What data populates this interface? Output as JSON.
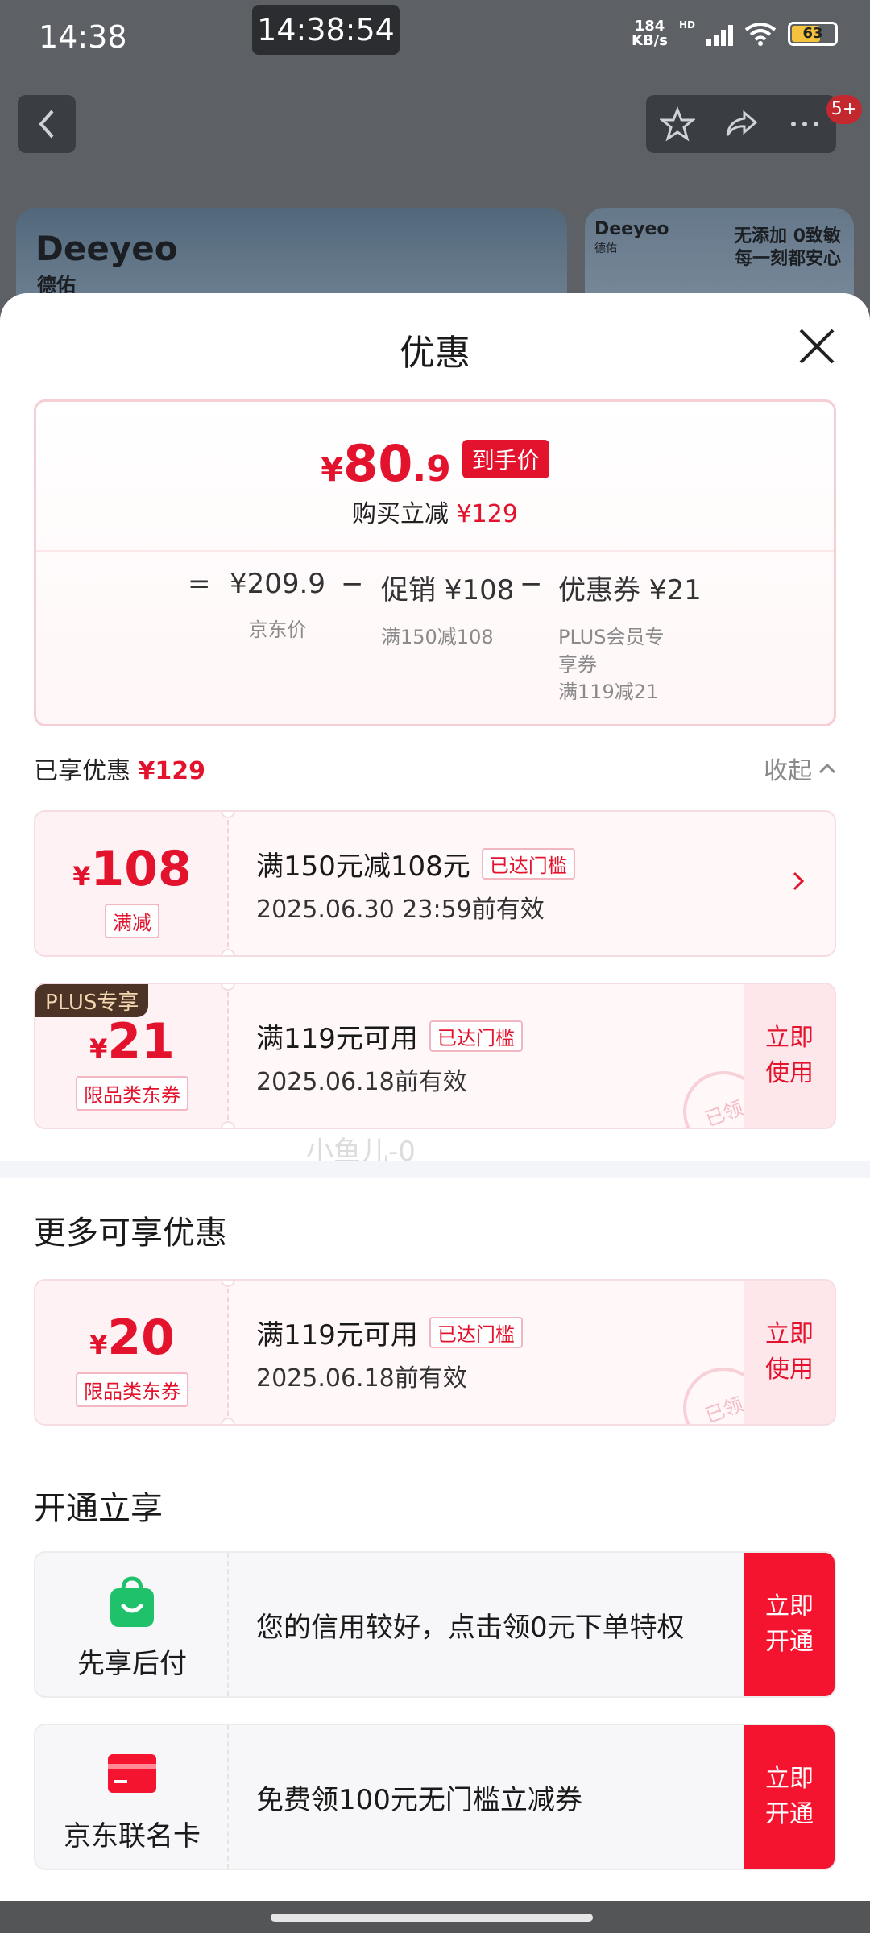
{
  "status_bar": {
    "time": "14:38",
    "clock_overlay": "14:38:54",
    "net_speed_value": "184",
    "net_speed_unit": "KB/s",
    "hd": "HD",
    "battery": "63"
  },
  "background_page": {
    "badge": "5+",
    "banner_brand": "Deeyeo",
    "banner_brand_cn": "德佑",
    "banner2_brand": "Deeyeo",
    "banner2_brand_cn": "德佑",
    "banner2_slogan_line1": "无添加 0致敏",
    "banner2_slogan_line2": "每一刻都安心"
  },
  "sheet": {
    "title": "优惠",
    "summary": {
      "final_symbol": "¥",
      "final_int": "80",
      "final_dec": ".9",
      "final_tag": "到手价",
      "reduce_label": "购买立减",
      "reduce_amount": "¥129",
      "equals": "=",
      "minus": "−",
      "jd_price": "¥209.9",
      "jd_price_label": "京东价",
      "promo_value": "促销 ¥108",
      "promo_label": "满150减108",
      "coupon_value": "优惠券 ¥21",
      "coupon_label_line1": "PLUS会员专",
      "coupon_label_line2": "享券",
      "coupon_label_line3": "满119减21"
    },
    "enjoyed": {
      "label": "已享优惠",
      "amount": "¥129",
      "collapse": "收起"
    },
    "coupons_enjoyed": [
      {
        "symbol": "¥",
        "amount": "108",
        "kind": "满减",
        "title": "满150元减108元",
        "status": "已达门槛",
        "validity": "2025.06.30 23:59前有效"
      },
      {
        "plus_tag": "PLUS专享",
        "symbol": "¥",
        "amount": "21",
        "kind": "限品类东券",
        "title": "满119元可用",
        "status": "已达门槛",
        "validity": "2025.06.18前有效",
        "action": "立即使用",
        "stamp": "已领"
      }
    ],
    "watermark": "小鱼儿-0",
    "more_section": {
      "title": "更多可享优惠",
      "coupons": [
        {
          "symbol": "¥",
          "amount": "20",
          "kind": "限品类东券",
          "title": "满119元可用",
          "status": "已达门槛",
          "validity": "2025.06.18前有效",
          "action": "立即使用",
          "stamp": "已领"
        }
      ]
    },
    "open_section": {
      "title": "开通立享",
      "items": [
        {
          "name": "先享后付",
          "icon": "shopping-bag-icon",
          "desc": "您的信用较好，点击领0元下单特权",
          "action": "立即开通"
        },
        {
          "name": "京东联名卡",
          "icon": "credit-card-icon",
          "desc": "免费领100元无门槛立减券",
          "action": "立即开通"
        }
      ]
    }
  },
  "colors": {
    "accent_red": "#e3132d",
    "button_red": "#f5142f",
    "plus_tag_bg": "#4b3426",
    "green_icon": "#1fc26b"
  }
}
